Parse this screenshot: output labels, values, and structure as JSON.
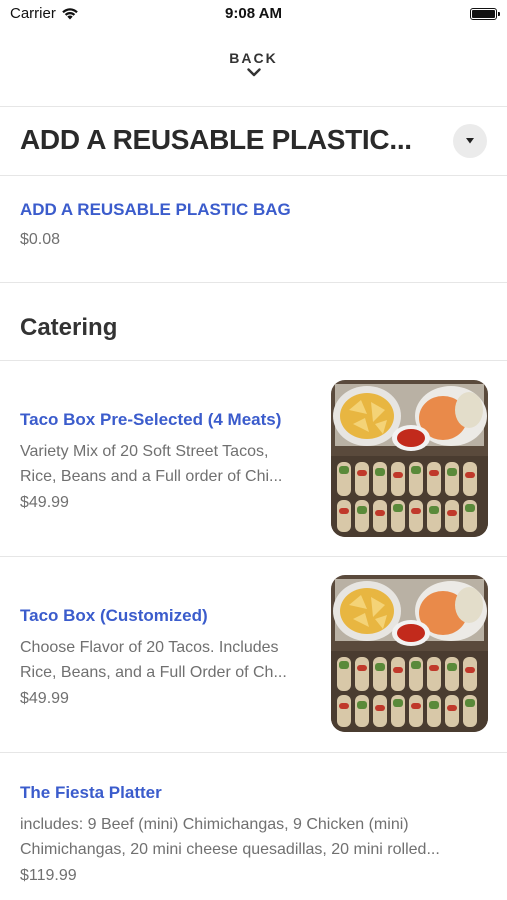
{
  "status_bar": {
    "carrier": "Carrier",
    "time": "9:08 AM",
    "icons": [
      "wifi-icon",
      "battery-icon"
    ]
  },
  "nav": {
    "back_label": "BACK",
    "back_icon": "chevron-down-icon"
  },
  "section": {
    "title": "ADD A REUSABLE PLASTIC...",
    "dropdown_icon": "caret-down-icon"
  },
  "bag_item": {
    "name": "ADD A REUSABLE PLASTIC BAG",
    "price": "$0.08"
  },
  "catering": {
    "title": "Catering",
    "items": [
      {
        "name": "Taco Box Pre-Selected (4 Meats)",
        "desc_line1": "Variety Mix  of 20 Soft Street Tacos,",
        "desc_line2": "Rice, Beans and a Full order of Chi...",
        "price": "$49.99",
        "image": "taco-box-photo"
      },
      {
        "name": "Taco Box (Customized)",
        "desc_line1": "Choose Flavor of 20 Tacos. Includes",
        "desc_line2": "Rice, Beans, and a Full Order of Ch...",
        "price": "$49.99",
        "image": "taco-box-photo"
      },
      {
        "name": "The Fiesta Platter",
        "desc_line1": "includes: 9 Beef (mini) Chimichangas, 9 Chicken (mini)",
        "desc_line2": "Chimichangas, 20 mini cheese quesadillas, 20 mini rolled...",
        "price": "$119.99"
      }
    ]
  },
  "colors": {
    "accent": "#3b5ccc",
    "text_dark": "#2a2a2a",
    "text_muted": "#707070",
    "divider": "#e6e6e6"
  }
}
